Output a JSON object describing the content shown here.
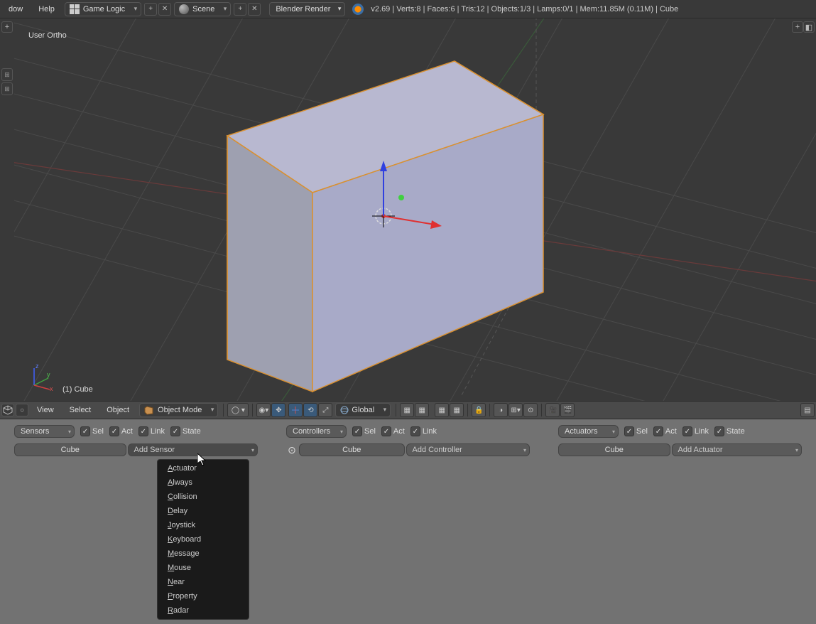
{
  "topbar": {
    "menus": {
      "dow": "dow",
      "help": "Help"
    },
    "editor1": "Game Logic",
    "editor2": "Scene",
    "render": "Blender Render",
    "stats": "v2.69 | Verts:8 | Faces:6 | Tris:12 | Objects:1/3 | Lamps:0/1 | Mem:11.85M (0.11M) | Cube"
  },
  "viewport": {
    "persp": "User Ortho",
    "object": "(1) Cube"
  },
  "header3d": {
    "menus": {
      "view": "View",
      "select": "Select",
      "object": "Object"
    },
    "mode": "Object Mode",
    "orient": "Global"
  },
  "logic": {
    "sensors": {
      "dd": "Sensors",
      "checks": {
        "sel": "Sel",
        "act": "Act",
        "link": "Link",
        "state": "State"
      },
      "cube": "Cube",
      "add": "Add Sensor"
    },
    "controllers": {
      "dd": "Controllers",
      "checks": {
        "sel": "Sel",
        "act": "Act",
        "link": "Link"
      },
      "cube": "Cube",
      "add": "Add Controller"
    },
    "actuators": {
      "dd": "Actuators",
      "checks": {
        "sel": "Sel",
        "act": "Act",
        "link": "Link",
        "state": "State"
      },
      "cube": "Cube",
      "add": "Add Actuator"
    }
  },
  "menu": {
    "items": [
      "Actuator",
      "Always",
      "Collision",
      "Delay",
      "Joystick",
      "Keyboard",
      "Message",
      "Mouse",
      "Near",
      "Property",
      "Radar"
    ]
  }
}
